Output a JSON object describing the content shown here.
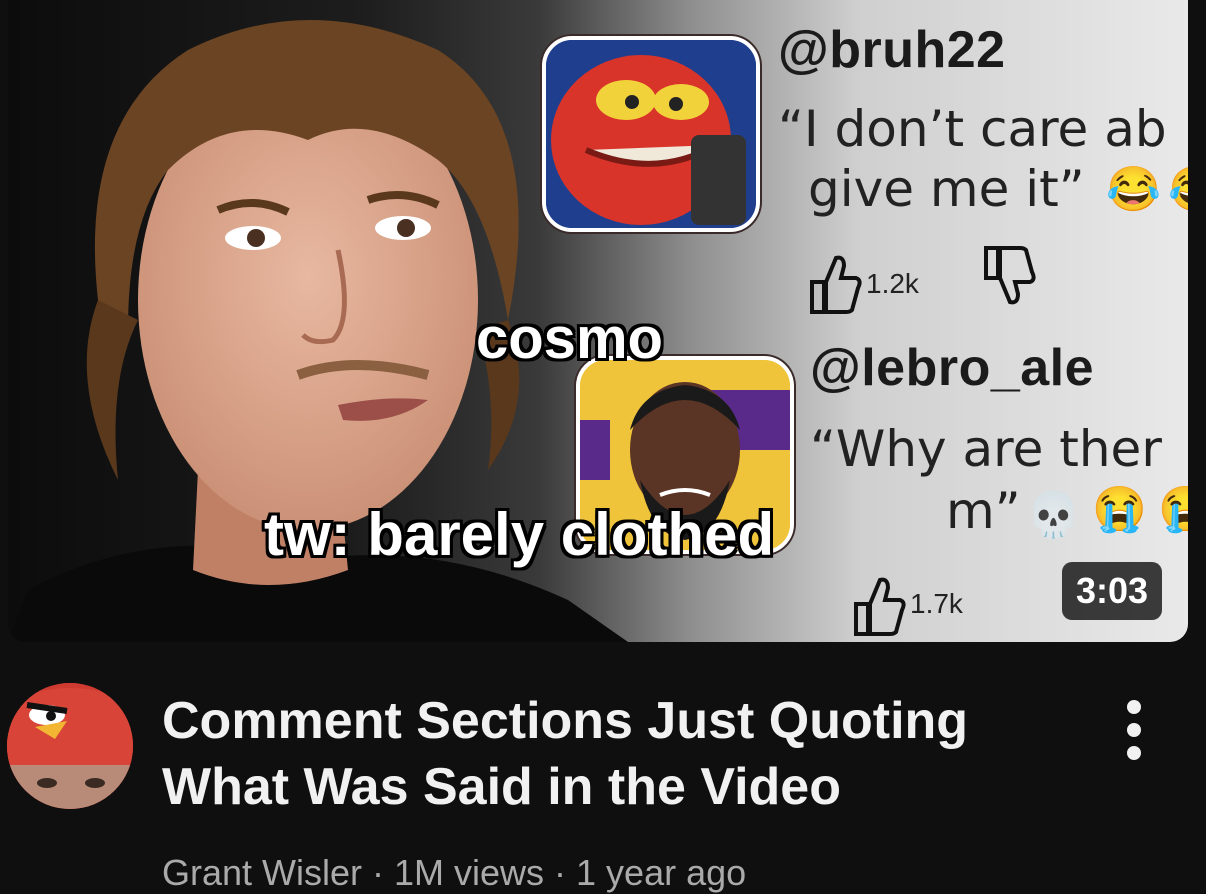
{
  "thumbnail": {
    "overlay_top": "cosmo",
    "overlay_bottom": "tw: barely clothed",
    "duration": "3:03",
    "comments": [
      {
        "handle": "@bruh22",
        "quote_line1": "“I don’t care ab",
        "quote_line2": "give me it”",
        "emojis": [
          "😂",
          "😂"
        ],
        "likes": "1.2k",
        "avatar_icon": "red-cartoon-character-avatar"
      },
      {
        "handle": "@lebro_ale",
        "quote_line1": "“Why are ther",
        "quote_line2": "m”",
        "emojis": [
          "💀",
          "😭",
          "😭"
        ],
        "likes": "1.7k",
        "avatar_icon": "basketball-player-avatar"
      }
    ]
  },
  "video": {
    "title_line1": "Comment Sections Just Quoting",
    "title_line2": "What Was Said in the Video",
    "subline": "Grant Wisler · 1M views · 1 year ago",
    "channel_avatar_icon": "angry-bird-hat-avatar",
    "menu_icon": "more-vertical-icon"
  },
  "colors": {
    "background": "#0f0f0f",
    "title": "#f1f1f1",
    "secondary_text": "#aaaaaa"
  }
}
